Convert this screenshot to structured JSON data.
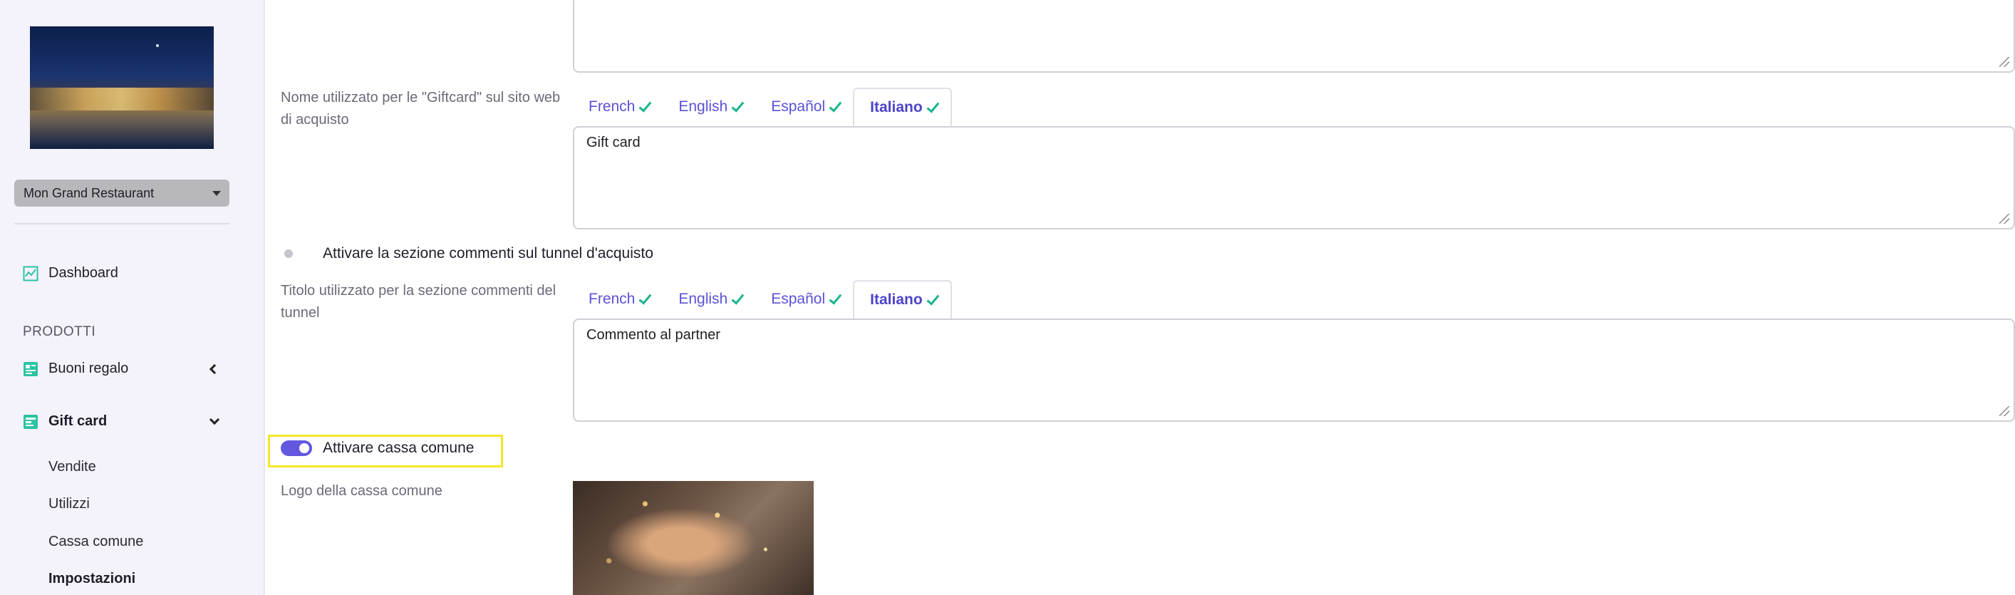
{
  "sidebar": {
    "restaurant_select": "Mon Grand Restaurant",
    "nav": {
      "dashboard": "Dashboard",
      "section_products": "PRODOTTI",
      "buoni_regalo": "Buoni regalo",
      "gift_card": "Gift card"
    },
    "gift_card_sub": {
      "vendite": "Vendite",
      "utilizzi": "Utilizzi",
      "cassa_comune": "Cassa comune",
      "impostazioni": "Impostazioni"
    }
  },
  "languages": {
    "french": "French",
    "english": "English",
    "espanol": "Español",
    "italiano": "Italiano"
  },
  "form": {
    "giftcard_name_label": "Nome utilizzato per le \"Giftcard\" sul sito web di acquisto",
    "giftcard_name_value": "Gift card",
    "comments_toggle_label": "Attivare la sezione commenti sul tunnel d'acquisto",
    "comments_toggle_on": false,
    "comments_title_label": "Titolo utilizzato per la sezione commenti del tunnel",
    "comments_title_value": "Commento al partner",
    "shared_pot_toggle_label": "Attivare cassa comune",
    "shared_pot_toggle_on": true,
    "shared_pot_logo_label": "Logo della cassa comune"
  },
  "colors": {
    "accent": "#5b52d8",
    "check": "#1bb58d",
    "highlight": "#f4e62a",
    "sidebar_bg": "#f4f3fb"
  }
}
